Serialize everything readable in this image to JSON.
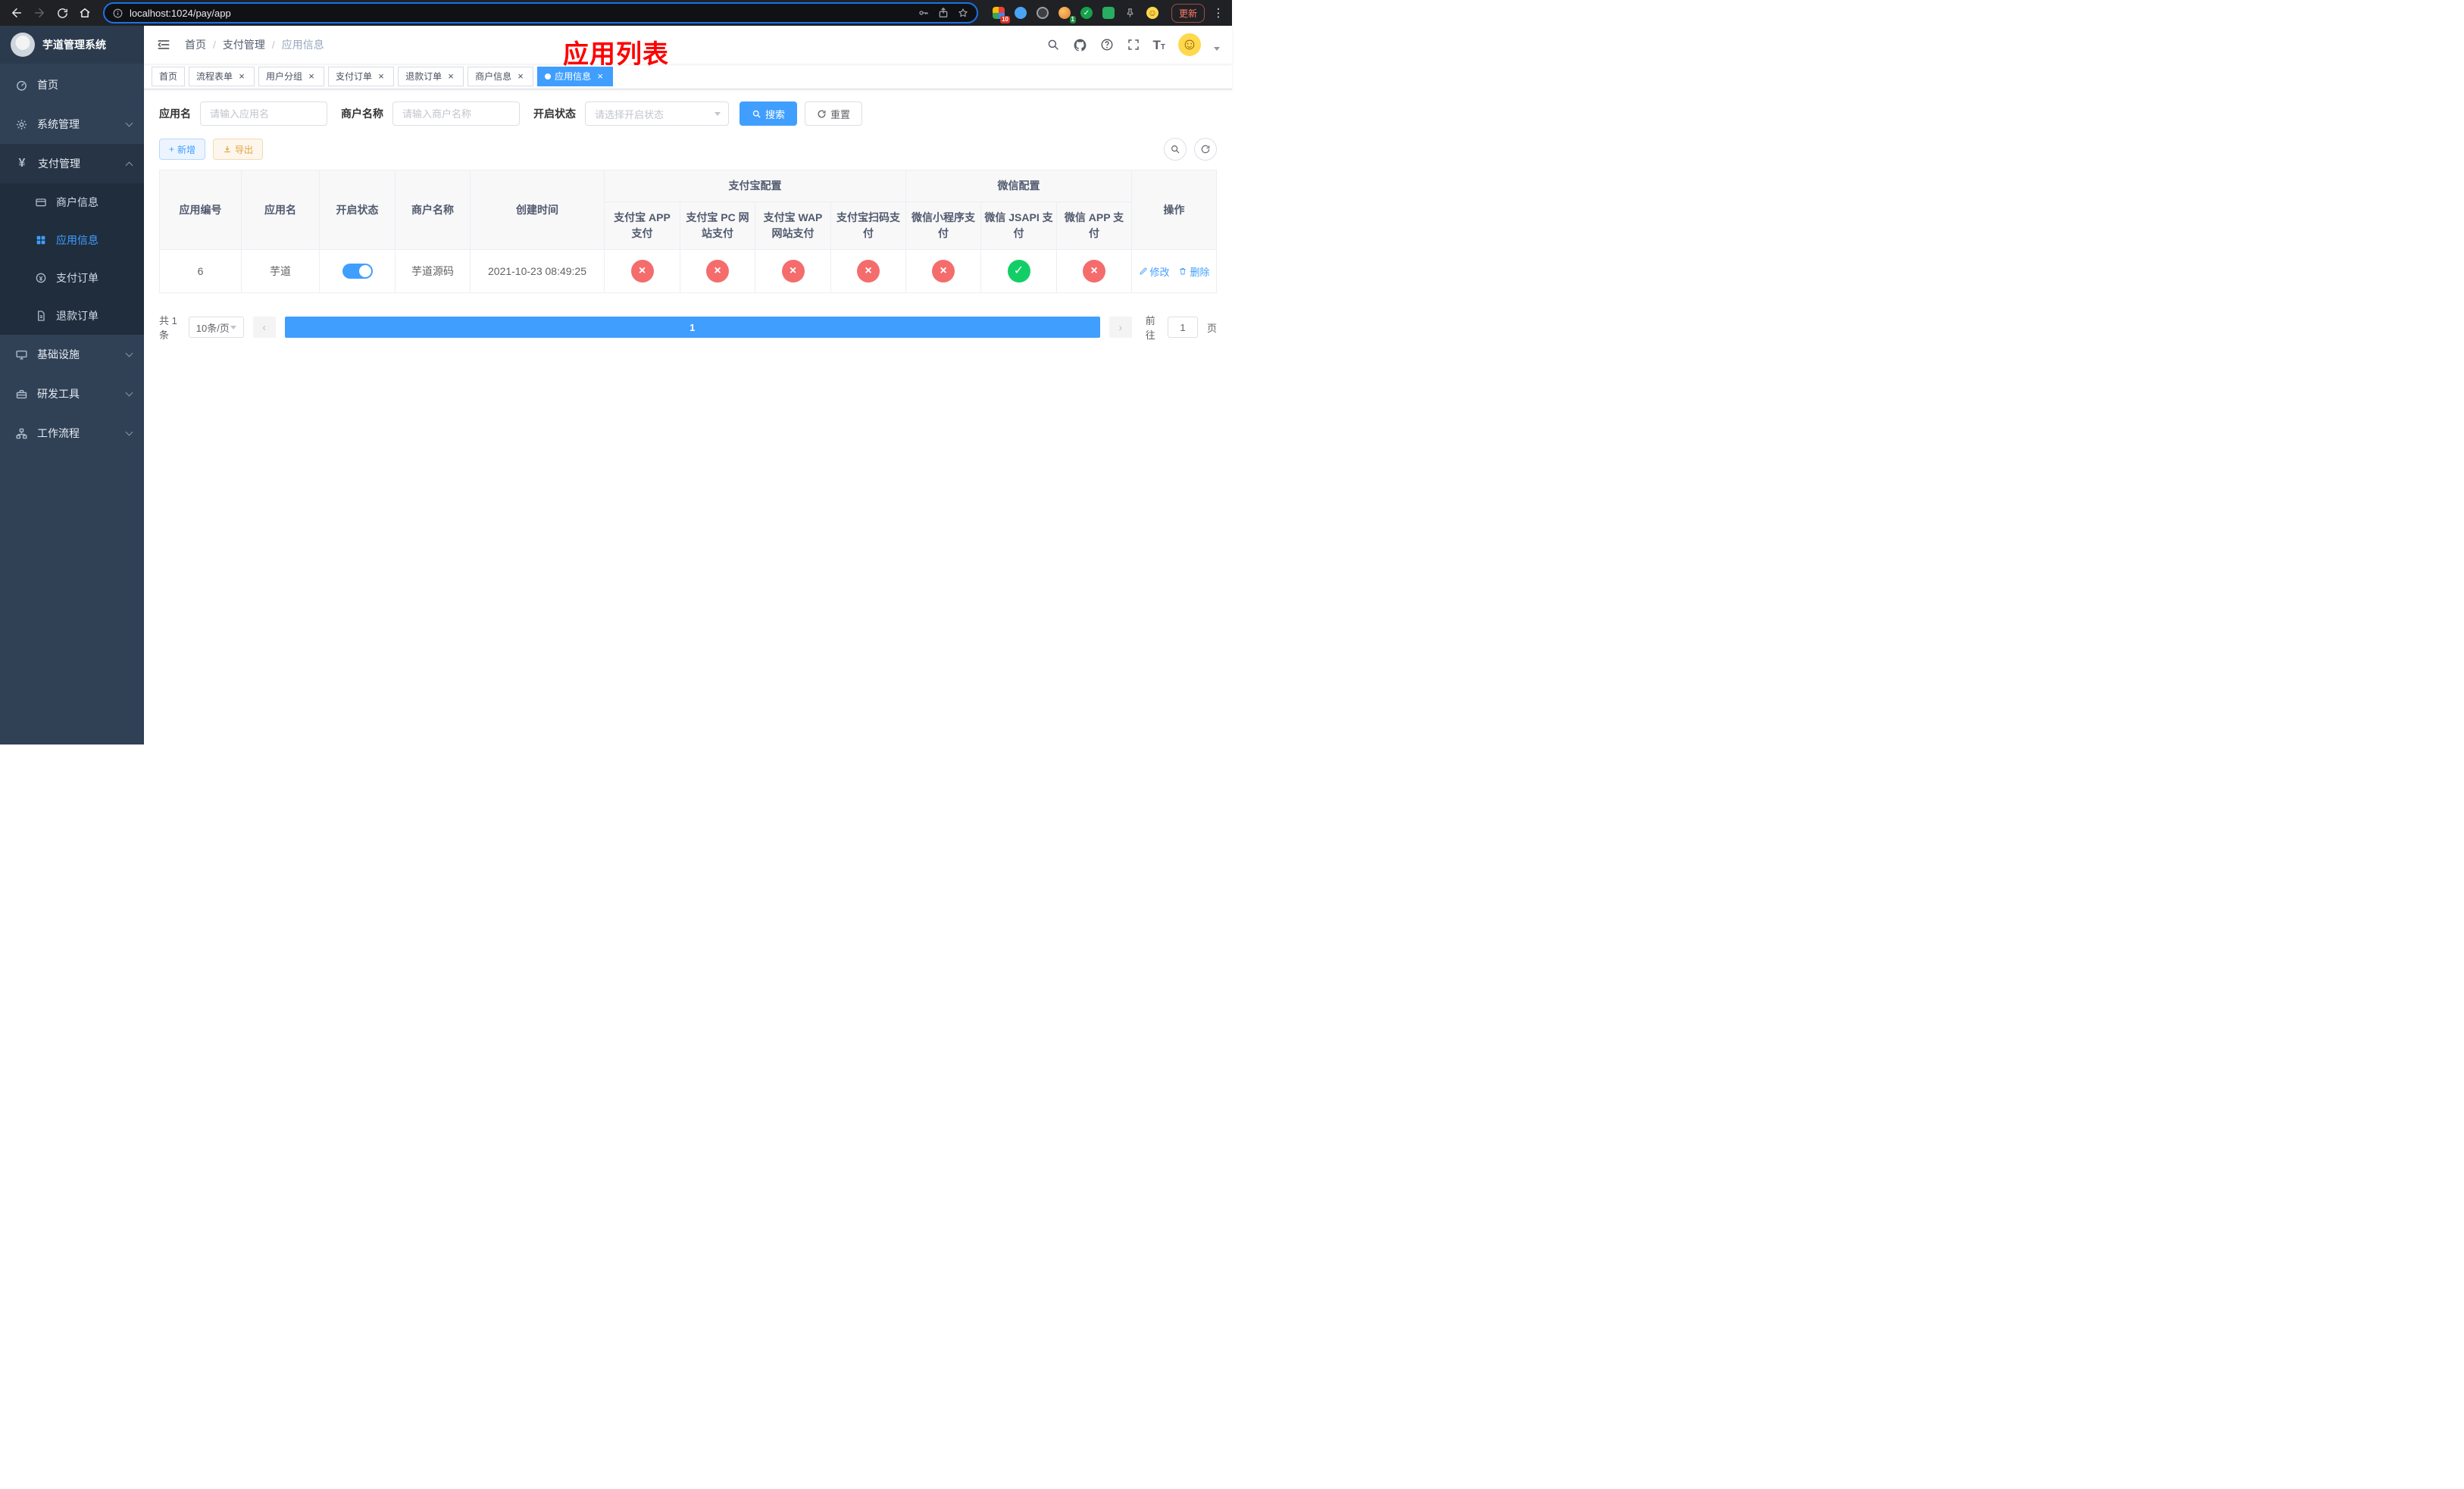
{
  "colors": {
    "primary": "#409eff",
    "danger": "#f56c6c",
    "success": "#13ce66",
    "warning": "#e6a23c",
    "annotation": "#ff0000"
  },
  "icons": {
    "close": "×",
    "check": "✓",
    "kebab": "⋮",
    "plus": "+",
    "yen": "¥",
    "smiley": "☺",
    "prev": "‹",
    "next": "›",
    "font_big": "T",
    "font_small": "T"
  },
  "browser": {
    "url": "localhost:1024/pay/app",
    "update_label": "更新",
    "ext_badge_1": "10",
    "ext_badge_2": "1"
  },
  "sidebar": {
    "title": "芋道管理系统",
    "menu": {
      "home": "首页",
      "system": "系统管理",
      "payment": "支付管理",
      "merchant_info": "商户信息",
      "app_info": "应用信息",
      "pay_order": "支付订单",
      "refund_order": "退款订单",
      "infrastructure": "基础设施",
      "dev_tools": "研发工具",
      "workflow": "工作流程"
    }
  },
  "navbar": {
    "breadcrumb": [
      "首页",
      "支付管理",
      "应用信息"
    ],
    "separator": "/"
  },
  "annotation": "应用列表",
  "tabs": [
    {
      "label": "首页",
      "closable": false,
      "active": false
    },
    {
      "label": "流程表单",
      "closable": true,
      "active": false
    },
    {
      "label": "用户分组",
      "closable": true,
      "active": false
    },
    {
      "label": "支付订单",
      "closable": true,
      "active": false
    },
    {
      "label": "退款订单",
      "closable": true,
      "active": false
    },
    {
      "label": "商户信息",
      "closable": true,
      "active": false
    },
    {
      "label": "应用信息",
      "closable": true,
      "active": true
    }
  ],
  "filters": {
    "app_name_label": "应用名",
    "app_name_placeholder": "请输入应用名",
    "app_name_value": "",
    "merchant_label": "商户名称",
    "merchant_placeholder": "请输入商户名称",
    "merchant_value": "",
    "status_label": "开启状态",
    "status_placeholder": "请选择开启状态",
    "search_label": "搜索",
    "reset_label": "重置"
  },
  "toolbar": {
    "add_label": "新增",
    "export_label": "导出"
  },
  "table": {
    "columns": [
      "应用编号",
      "应用名",
      "开启状态",
      "商户名称",
      "创建时间",
      "支付宝 APP 支付",
      "支付宝 PC 网站支付",
      "支付宝 WAP 网站支付",
      "支付宝扫码支付",
      "微信小程序支付",
      "微信 JSAPI 支付",
      "微信 APP 支付",
      "操作"
    ],
    "groups": [
      {
        "label": "支付宝配置",
        "span": 4
      },
      {
        "label": "微信配置",
        "span": 3
      }
    ],
    "rows": [
      {
        "app_no": "6",
        "app_name": "芋道",
        "status_on": true,
        "merchant": "芋道源码",
        "created_at": "2021-10-23 08:49:25",
        "channels": [
          "closed",
          "closed",
          "closed",
          "closed",
          "closed",
          "enabled",
          "closed"
        ],
        "edit_label": "修改",
        "delete_label": "删除"
      }
    ]
  },
  "pagination": {
    "total_text": "共 1 条",
    "page_size": "10条/页",
    "current_page": "1",
    "goto_label": "前往",
    "goto_value": "1",
    "goto_unit": "页"
  }
}
